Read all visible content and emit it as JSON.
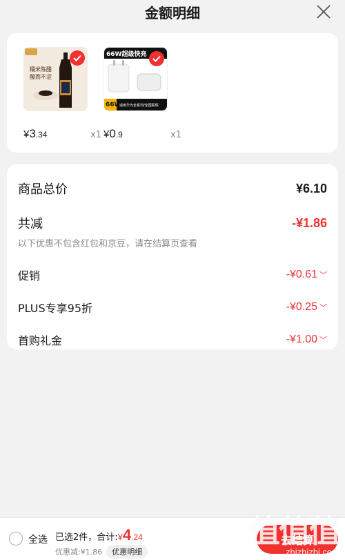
{
  "header": {
    "title": "金额明细"
  },
  "products": [
    {
      "image_text": [
        "糯米陈醋",
        "酸而不涩",
        "镇江陈醋"
      ],
      "price_yen": "¥",
      "price_int": "3",
      "price_dec": ".34",
      "qty": "x1"
    },
    {
      "image_text": [
        "66W超级快充",
        "66W",
        "适用华为全系列/全国联保"
      ],
      "price_yen": "¥",
      "price_int": "0",
      "price_dec": ".9",
      "qty": "x1"
    }
  ],
  "summary": {
    "total_label": "商品总价",
    "total_value": "¥6.10",
    "reduce_label": "共减",
    "reduce_value": "-¥1.86",
    "note": "以下优惠不包含红包和京豆，请在结算页查看",
    "items": [
      {
        "label": "促销",
        "value": "-¥0.61"
      },
      {
        "label": "PLUS专享95折",
        "value": "-¥0.25"
      },
      {
        "label": "首购礼金",
        "value": "-¥1.00"
      }
    ]
  },
  "footer": {
    "select_all": "全选",
    "selected_text": "已选2件，合计:",
    "amount_yen": "¥",
    "amount_int": "4",
    "amount_dec": ".24",
    "discount_text": "优惠减:¥1.86",
    "detail_button": "优惠明细",
    "checkout_button": "去结算"
  },
  "watermark": {
    "big": "值值值",
    "small": "zhizhizhi.com"
  },
  "colors": {
    "accent": "#f23030",
    "background": "#f2f2f2"
  }
}
